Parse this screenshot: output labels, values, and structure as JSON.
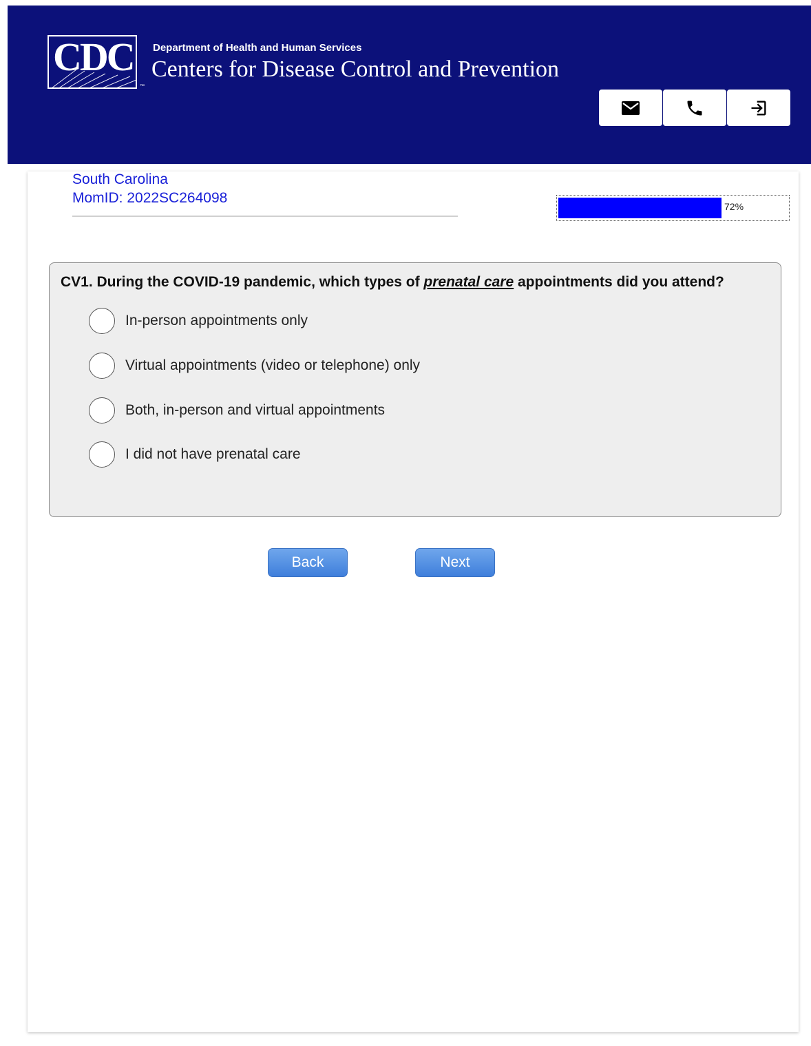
{
  "header": {
    "logo_text": "CDC",
    "logo_tm": "™",
    "department": "Department of Health and Human Services",
    "agency": "Centers for Disease Control and Prevention",
    "background_color": "#0c117a",
    "buttons": [
      {
        "icon": "mail-icon"
      },
      {
        "icon": "phone-icon"
      },
      {
        "icon": "exit-icon"
      }
    ]
  },
  "respondent": {
    "state": "South Carolina",
    "mom_id": "MomID: 2022SC264098"
  },
  "progress": {
    "value_percent": 72,
    "label": "72%",
    "fill_color": "#0000ff"
  },
  "question": {
    "prefix": "CV1. During the COVID-19 pandemic, which types of ",
    "emphasis": "prenatal care",
    "suffix": " appointments did you attend?",
    "options": [
      {
        "label": "In-person appointments only",
        "selected": false
      },
      {
        "label": "Virtual appointments (video or telephone) only",
        "selected": false
      },
      {
        "label": "Both, in-person and virtual appointments",
        "selected": false
      },
      {
        "label": "I did not have prenatal care",
        "selected": false
      }
    ]
  },
  "navigation": {
    "back_label": "Back",
    "next_label": "Next"
  }
}
